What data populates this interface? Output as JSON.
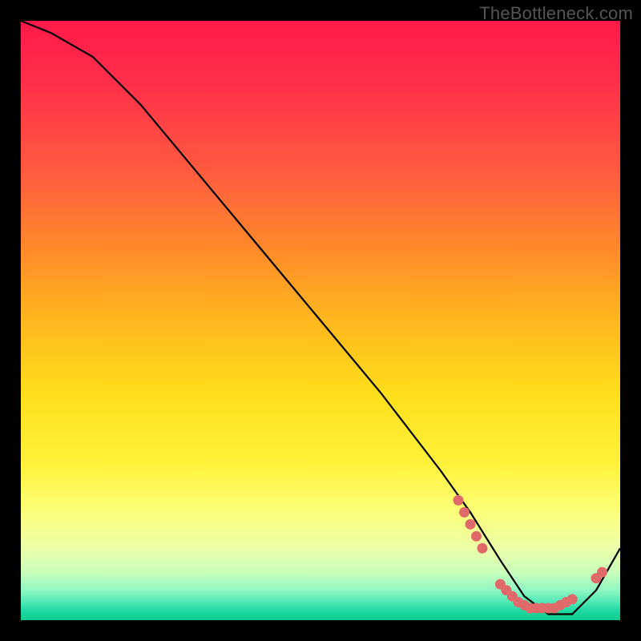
{
  "watermark": "TheBottleneck.com",
  "chart_data": {
    "type": "line",
    "title": "",
    "xlabel": "",
    "ylabel": "",
    "xlim": [
      0,
      100
    ],
    "ylim": [
      0,
      100
    ],
    "grid": false,
    "series": [
      {
        "name": "bottleneck-curve",
        "color": "#000000",
        "x": [
          0,
          5,
          12,
          20,
          30,
          40,
          50,
          60,
          70,
          75,
          80,
          84,
          88,
          92,
          96,
          100
        ],
        "y": [
          100,
          98,
          94,
          86,
          74,
          62,
          50,
          38,
          25,
          18,
          10,
          4,
          1,
          1,
          5,
          12
        ]
      }
    ],
    "markers": [
      {
        "name": "highlight-dots",
        "color": "#e06a6a",
        "radius_px": 6.5,
        "points": [
          {
            "x": 73,
            "y": 20
          },
          {
            "x": 74,
            "y": 18
          },
          {
            "x": 75,
            "y": 16
          },
          {
            "x": 76,
            "y": 14
          },
          {
            "x": 77,
            "y": 12
          },
          {
            "x": 80,
            "y": 6
          },
          {
            "x": 81,
            "y": 5
          },
          {
            "x": 82,
            "y": 4
          },
          {
            "x": 83,
            "y": 3
          },
          {
            "x": 84,
            "y": 2.5
          },
          {
            "x": 85,
            "y": 2
          },
          {
            "x": 86,
            "y": 2
          },
          {
            "x": 87,
            "y": 2
          },
          {
            "x": 88,
            "y": 2
          },
          {
            "x": 89,
            "y": 2
          },
          {
            "x": 90,
            "y": 2.5
          },
          {
            "x": 91,
            "y": 3
          },
          {
            "x": 92,
            "y": 3.5
          },
          {
            "x": 96,
            "y": 7
          },
          {
            "x": 97,
            "y": 8
          }
        ]
      }
    ],
    "background_gradient": {
      "top_color": "#ff1a4a",
      "mid_color": "#ffde1a",
      "bottom_color": "#0fc993"
    }
  }
}
